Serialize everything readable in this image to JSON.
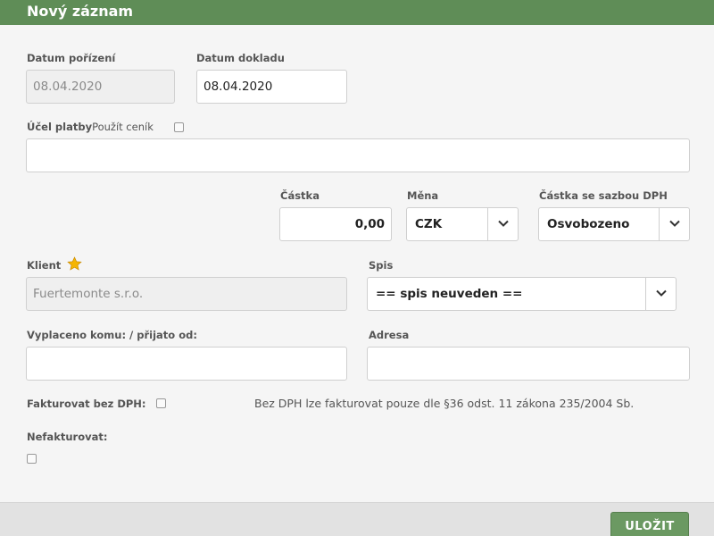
{
  "dialog": {
    "title": "Nový záznam"
  },
  "datum_porizeni": {
    "label": "Datum pořízení",
    "value": "08.04.2020"
  },
  "datum_dokladu": {
    "label": "Datum dokladu",
    "value": "08.04.2020"
  },
  "ucel_platby": {
    "label": "Účel platby",
    "cenik_label": "Použít ceník",
    "value": ""
  },
  "castka": {
    "label": "Částka",
    "value": "0,00"
  },
  "mena": {
    "label": "Měna",
    "value": "CZK"
  },
  "sazba_dph": {
    "label": "Částka se sazbou DPH",
    "value": "Osvobozeno"
  },
  "klient": {
    "label": "Klient",
    "value": "Fuertemonte s.r.o."
  },
  "spis": {
    "label": "Spis",
    "value": "== spis neuveden =="
  },
  "vyplaceno": {
    "label": "Vyplaceno komu: / přijato od:",
    "value": ""
  },
  "adresa": {
    "label": "Adresa",
    "value": ""
  },
  "fakturovat_bez_dph": {
    "label": "Fakturovat bez DPH:",
    "note": "Bez DPH lze fakturovat pouze dle §36 odst. 11 zákona 235/2004 Sb."
  },
  "nefakturovat": {
    "label": "Nefakturovat:"
  },
  "footer": {
    "save_label": "ULOŽIT"
  },
  "colors": {
    "header": "#5f8d57",
    "button": "#6b9962",
    "star": "#f5b500"
  }
}
